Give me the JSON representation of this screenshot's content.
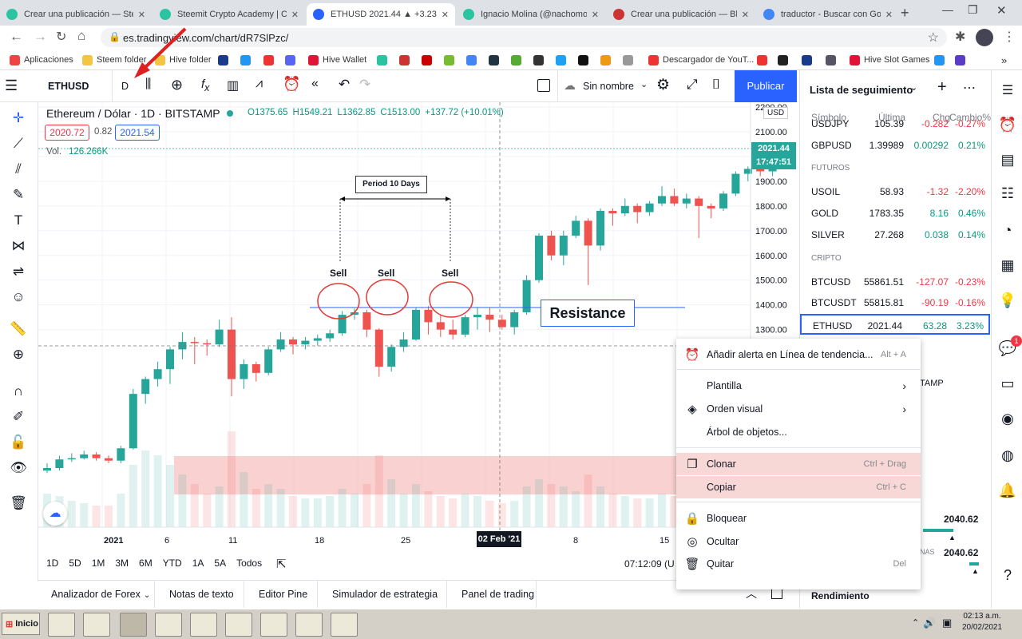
{
  "tabs": [
    {
      "title": "Crear una publicación — Stee",
      "color": "#2bc4a0"
    },
    {
      "title": "Steemit Crypto Academy | Cr",
      "color": "#2bc4a0"
    },
    {
      "title": "ETHUSD 2021.44 ▲ +3.23%",
      "color": "#2962ff"
    },
    {
      "title": "Ignacio Molina (@nachomolin",
      "color": "#2bc4a0"
    },
    {
      "title": "Crear una publicación — Blurt",
      "color": "#c33"
    },
    {
      "title": "traductor - Buscar con Googl",
      "color": "#4285f4"
    }
  ],
  "browser": {
    "url": "es.tradingview.com/chart/dR7SlPzc/"
  },
  "bookmarks": [
    {
      "label": "Aplicaciones",
      "color": "#e44"
    },
    {
      "label": "Steem folder",
      "color": "#f4c542"
    },
    {
      "label": "Hive folder",
      "color": "#f4c542"
    },
    {
      "label": "",
      "color": "#1a3a8a"
    },
    {
      "label": "",
      "color": "#2196f3"
    },
    {
      "label": "",
      "color": "#e33"
    },
    {
      "label": "",
      "color": "#5865f2"
    },
    {
      "label": "Hive Wallet",
      "color": "#e31337"
    },
    {
      "label": "",
      "color": "#2bc4a0"
    },
    {
      "label": "",
      "color": "#c33"
    },
    {
      "label": "",
      "color": "#c00"
    },
    {
      "label": "",
      "color": "#7b3"
    },
    {
      "label": "",
      "color": "#4285f4"
    },
    {
      "label": "",
      "color": "#234"
    },
    {
      "label": "",
      "color": "#5a3"
    },
    {
      "label": "",
      "color": "#333"
    },
    {
      "label": "",
      "color": "#1da1f2"
    },
    {
      "label": "",
      "color": "#111"
    },
    {
      "label": "",
      "color": "#e91"
    },
    {
      "label": "",
      "color": "#999"
    },
    {
      "label": "Descargador de YouT...",
      "color": "#e33"
    },
    {
      "label": "",
      "color": "#e33"
    },
    {
      "label": "",
      "color": "#222"
    },
    {
      "label": "",
      "color": "#1a3a8a"
    },
    {
      "label": "",
      "color": "#556"
    },
    {
      "label": "Hive Slot Games",
      "color": "#e31337"
    },
    {
      "label": "",
      "color": "#2196f3"
    },
    {
      "label": "",
      "color": "#5b3cc4"
    }
  ],
  "toolbar": {
    "symbol": "ETHUSD",
    "interval": "D",
    "layout_name": "Sin nombre",
    "publish": "Publicar"
  },
  "legend": {
    "title": "Ethereum / Dólar · 1D · BITSTAMP",
    "o": "O1375.65",
    "h": "H1549.21",
    "l": "L1362.85",
    "c": "C1513.00",
    "chg": "+137.72 (+10.01%)",
    "bid": "2020.72",
    "spread": "0.82",
    "ask": "2021.54",
    "vol_label": "Vol.",
    "vol_value": "126.266K"
  },
  "annotations": {
    "period": "Period 10 Days",
    "sell": "Sell",
    "resistance": "Resistance"
  },
  "price_axis": {
    "currency": "USD",
    "last_price": "2021.44",
    "countdown": "17:47:51",
    "ticks": [
      "2200.00",
      "2100.00",
      "2000.00",
      "1900.00",
      "1800.00",
      "1700.00",
      "1600.00",
      "1500.00",
      "1400.00",
      "1300.00"
    ]
  },
  "time_axis": {
    "ticks": [
      "2021",
      "6",
      "11",
      "18",
      "25",
      "8",
      "15"
    ],
    "cursor_label": "02 Feb '21"
  },
  "ranges": [
    "1D",
    "5D",
    "1M",
    "3M",
    "6M",
    "YTD",
    "1A",
    "5A",
    "Todos"
  ],
  "clock": "07:12:09 (U",
  "bottom_tabs": [
    "Analizador de Forex",
    "Notas de texto",
    "Editor Pine",
    "Simulador de estrategia",
    "Panel de trading"
  ],
  "watchlist": {
    "title": "Lista de seguimiento",
    "headers": [
      "Símbolo",
      "Última",
      "Chg",
      "Cambio%"
    ],
    "rows": [
      {
        "type": "row",
        "symbol": "USDJPY",
        "last": "105.39",
        "chg": "-0.282",
        "pct": "-0.27%",
        "dir": "down"
      },
      {
        "type": "row",
        "symbol": "GBPUSD",
        "last": "1.39989",
        "chg": "0.00292",
        "pct": "0.21%",
        "dir": "up"
      },
      {
        "type": "section",
        "label": "FUTUROS"
      },
      {
        "type": "row",
        "symbol": "USOIL",
        "last": "58.93",
        "chg": "-1.32",
        "pct": "-2.20%",
        "dir": "down"
      },
      {
        "type": "row",
        "symbol": "GOLD",
        "last": "1783.35",
        "chg": "8.16",
        "pct": "0.46%",
        "dir": "up"
      },
      {
        "type": "row",
        "symbol": "SILVER",
        "last": "27.268",
        "chg": "0.038",
        "pct": "0.14%",
        "dir": "up"
      },
      {
        "type": "section",
        "label": "CRIPTO"
      },
      {
        "type": "row",
        "symbol": "BTCUSD",
        "last": "55861.51",
        "chg": "-127.07",
        "pct": "-0.23%",
        "dir": "down"
      },
      {
        "type": "row",
        "symbol": "BTCUSDT",
        "last": "55815.81",
        "chg": "-90.19",
        "pct": "-0.16%",
        "dir": "down"
      },
      {
        "type": "row",
        "symbol": "ETHUSD",
        "last": "2021.44",
        "chg": "63.28",
        "pct": "3.23%",
        "dir": "up",
        "selected": true
      }
    ],
    "partial_tamp": "TAMP",
    "gauge1_value": "2040.62",
    "gauge2_label": "NAS",
    "gauge2_value": "2040.62",
    "footer": "Rendimiento"
  },
  "context_menu": {
    "items": [
      {
        "label": "Añadir alerta en Línea de tendencia...",
        "shortcut": "Alt + A",
        "icon": "alarm-clock-icon",
        "glyph": "⏰"
      },
      {
        "label": "Plantilla",
        "arrow": true,
        "icon": "",
        "glyph": ""
      },
      {
        "label": "Orden visual",
        "arrow": true,
        "icon": "layers-icon",
        "glyph": "◈"
      },
      {
        "label": "Árbol de objetos...",
        "icon": "",
        "glyph": ""
      },
      {
        "label": "Clonar",
        "shortcut": "Ctrl + Drag",
        "icon": "clone-icon",
        "glyph": "❐"
      },
      {
        "label": "Copiar",
        "shortcut": "Ctrl + C",
        "icon": "",
        "glyph": ""
      },
      {
        "label": "Bloquear",
        "icon": "lock-icon",
        "glyph": "🔒"
      },
      {
        "label": "Ocultar",
        "icon": "eye-off-icon",
        "glyph": "◎"
      },
      {
        "label": "Quitar",
        "shortcut": "Del",
        "icon": "trash-icon",
        "glyph": "🗑"
      }
    ]
  },
  "taskbar": {
    "start": "Inicio",
    "time": "02:13 a.m.",
    "date": "20/02/2021"
  },
  "colors": {
    "up": "#26a69a",
    "down": "#ef5350",
    "accent": "#2962ff"
  },
  "chart_data": {
    "type": "candlestick",
    "symbol": "ETHUSD",
    "ylim": [
      1100,
      2250
    ],
    "candles": [
      {
        "o": 730,
        "h": 760,
        "l": 720,
        "c": 740,
        "v": 70
      },
      {
        "o": 740,
        "h": 790,
        "l": 730,
        "c": 775,
        "v": 65
      },
      {
        "o": 775,
        "h": 800,
        "l": 765,
        "c": 780,
        "v": 55
      },
      {
        "o": 780,
        "h": 810,
        "l": 775,
        "c": 795,
        "v": 50
      },
      {
        "o": 795,
        "h": 805,
        "l": 770,
        "c": 780,
        "v": 45
      },
      {
        "o": 780,
        "h": 790,
        "l": 760,
        "c": 770,
        "v": 45
      },
      {
        "o": 770,
        "h": 830,
        "l": 760,
        "c": 820,
        "v": 70
      },
      {
        "o": 820,
        "h": 1060,
        "l": 815,
        "c": 1040,
        "v": 130
      },
      {
        "o": 1040,
        "h": 1110,
        "l": 1000,
        "c": 1100,
        "v": 160
      },
      {
        "o": 1100,
        "h": 1170,
        "l": 1070,
        "c": 1140,
        "v": 150
      },
      {
        "o": 1140,
        "h": 1230,
        "l": 1080,
        "c": 1220,
        "v": 130
      },
      {
        "o": 1220,
        "h": 1290,
        "l": 1180,
        "c": 1250,
        "v": 110
      },
      {
        "o": 1250,
        "h": 1270,
        "l": 1160,
        "c": 1245,
        "v": 90
      },
      {
        "o": 1245,
        "h": 1260,
        "l": 1195,
        "c": 1240,
        "v": 70
      },
      {
        "o": 1240,
        "h": 1340,
        "l": 1230,
        "c": 1300,
        "v": 85
      },
      {
        "o": 1300,
        "h": 1350,
        "l": 1030,
        "c": 1100,
        "v": 200
      },
      {
        "o": 1100,
        "h": 1180,
        "l": 1060,
        "c": 1160,
        "v": 115
      },
      {
        "o": 1160,
        "h": 1170,
        "l": 1090,
        "c": 1125,
        "v": 80
      },
      {
        "o": 1125,
        "h": 1230,
        "l": 1115,
        "c": 1220,
        "v": 90
      },
      {
        "o": 1220,
        "h": 1290,
        "l": 1210,
        "c": 1260,
        "v": 80
      },
      {
        "o": 1260,
        "h": 1270,
        "l": 1200,
        "c": 1240,
        "v": 65
      },
      {
        "o": 1240,
        "h": 1270,
        "l": 1220,
        "c": 1255,
        "v": 60
      },
      {
        "o": 1255,
        "h": 1280,
        "l": 1235,
        "c": 1265,
        "v": 60
      },
      {
        "o": 1265,
        "h": 1300,
        "l": 1250,
        "c": 1285,
        "v": 65
      },
      {
        "o": 1285,
        "h": 1375,
        "l": 1275,
        "c": 1360,
        "v": 80
      },
      {
        "o": 1360,
        "h": 1385,
        "l": 1340,
        "c": 1370,
        "v": 70
      },
      {
        "o": 1370,
        "h": 1380,
        "l": 1270,
        "c": 1300,
        "v": 90
      },
      {
        "o": 1300,
        "h": 1305,
        "l": 1110,
        "c": 1150,
        "v": 150
      },
      {
        "o": 1150,
        "h": 1240,
        "l": 1130,
        "c": 1230,
        "v": 100
      },
      {
        "o": 1230,
        "h": 1290,
        "l": 1210,
        "c": 1260,
        "v": 70
      },
      {
        "o": 1260,
        "h": 1390,
        "l": 1255,
        "c": 1380,
        "v": 90
      },
      {
        "o": 1380,
        "h": 1395,
        "l": 1280,
        "c": 1330,
        "v": 75
      },
      {
        "o": 1330,
        "h": 1360,
        "l": 1270,
        "c": 1300,
        "v": 65
      },
      {
        "o": 1300,
        "h": 1340,
        "l": 1260,
        "c": 1280,
        "v": 60
      },
      {
        "o": 1280,
        "h": 1360,
        "l": 1270,
        "c": 1350,
        "v": 70
      },
      {
        "o": 1350,
        "h": 1390,
        "l": 1300,
        "c": 1360,
        "v": 65
      },
      {
        "o": 1360,
        "h": 1390,
        "l": 1290,
        "c": 1340,
        "v": 55
      },
      {
        "o": 1340,
        "h": 1360,
        "l": 1300,
        "c": 1310,
        "v": 50
      },
      {
        "o": 1310,
        "h": 1380,
        "l": 1280,
        "c": 1370,
        "v": 55
      },
      {
        "o": 1370,
        "h": 1520,
        "l": 1360,
        "c": 1500,
        "v": 85
      },
      {
        "o": 1500,
        "h": 1690,
        "l": 1490,
        "c": 1680,
        "v": 100
      },
      {
        "o": 1680,
        "h": 1700,
        "l": 1580,
        "c": 1600,
        "v": 90
      },
      {
        "o": 1600,
        "h": 1700,
        "l": 1560,
        "c": 1680,
        "v": 85
      },
      {
        "o": 1680,
        "h": 1760,
        "l": 1670,
        "c": 1740,
        "v": 75
      },
      {
        "o": 1740,
        "h": 1750,
        "l": 1480,
        "c": 1640,
        "v": 110
      },
      {
        "o": 1640,
        "h": 1790,
        "l": 1620,
        "c": 1780,
        "v": 85
      },
      {
        "o": 1780,
        "h": 1790,
        "l": 1720,
        "c": 1770,
        "v": 70
      },
      {
        "o": 1770,
        "h": 1830,
        "l": 1760,
        "c": 1800,
        "v": 65
      },
      {
        "o": 1800,
        "h": 1810,
        "l": 1730,
        "c": 1775,
        "v": 60
      },
      {
        "o": 1775,
        "h": 1820,
        "l": 1760,
        "c": 1810,
        "v": 60
      },
      {
        "o": 1810,
        "h": 1880,
        "l": 1800,
        "c": 1840,
        "v": 70
      },
      {
        "o": 1840,
        "h": 1870,
        "l": 1800,
        "c": 1810,
        "v": 65
      },
      {
        "o": 1810,
        "h": 1850,
        "l": 1790,
        "c": 1830,
        "v": 55
      },
      {
        "o": 1830,
        "h": 1840,
        "l": 1670,
        "c": 1800,
        "v": 85
      },
      {
        "o": 1800,
        "h": 1810,
        "l": 1750,
        "c": 1790,
        "v": 60
      },
      {
        "o": 1790,
        "h": 1860,
        "l": 1780,
        "c": 1850,
        "v": 65
      },
      {
        "o": 1850,
        "h": 1940,
        "l": 1840,
        "c": 1930,
        "v": 70
      },
      {
        "o": 1930,
        "h": 1960,
        "l": 1900,
        "c": 1950,
        "v": 65
      },
      {
        "o": 1950,
        "h": 1980,
        "l": 1920,
        "c": 1940,
        "v": 60
      },
      {
        "o": 1940,
        "h": 2040,
        "l": 1920,
        "c": 2021,
        "v": 70
      }
    ]
  }
}
